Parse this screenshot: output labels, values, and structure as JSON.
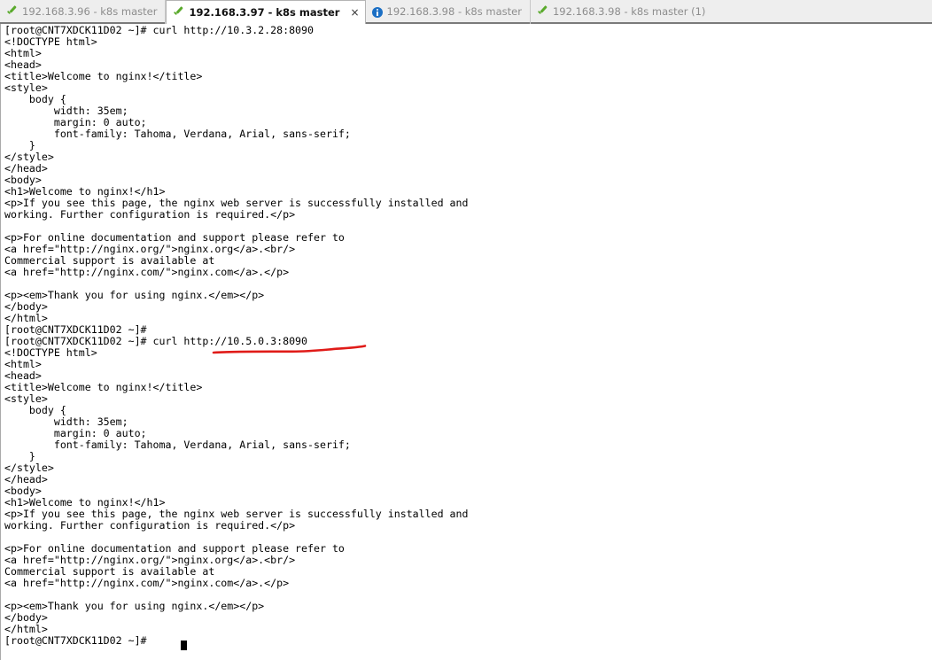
{
  "window": {
    "title": "192.168.3.97 - k8s master"
  },
  "tabbar": {
    "tabs": [
      {
        "label": "192.168.3.96 - k8s master",
        "icon": "green-check-icon",
        "active": false,
        "closable": false
      },
      {
        "label": "192.168.3.97 - k8s master",
        "icon": "green-check-icon",
        "active": true,
        "closable": true,
        "close_label": "×"
      },
      {
        "label": "192.168.3.98 - k8s master",
        "icon": "blue-info-icon",
        "active": false,
        "closable": false
      },
      {
        "label": "192.168.3.98 - k8s master (1)",
        "icon": "green-check-icon",
        "active": false,
        "closable": false
      }
    ]
  },
  "colors": {
    "tabbar_background": "#eeeeee",
    "tabbar_border": "#7a7a7a",
    "active_tab_background": "#ffffff",
    "inactive_tab_text": "#8d8d8d",
    "active_tab_text": "#111111",
    "check_icon": "#5aaa2c",
    "info_icon": "#1b6fc4",
    "terminal_background": "#ffffff",
    "terminal_text": "#000000",
    "annotation_red": "#e01b18"
  },
  "terminal": {
    "prompt": "[root@CNT7XDCK11D02 ~]#",
    "hostname": "CNT7XDCK11D02",
    "user": "root",
    "cwd": "~",
    "commands": [
      "curl http://10.3.2.28:8090",
      "curl http://10.5.0.3:8090"
    ],
    "content": "[root@CNT7XDCK11D02 ~]# curl http://10.3.2.28:8090\n<!DOCTYPE html>\n<html>\n<head>\n<title>Welcome to nginx!</title>\n<style>\n    body {\n        width: 35em;\n        margin: 0 auto;\n        font-family: Tahoma, Verdana, Arial, sans-serif;\n    }\n</style>\n</head>\n<body>\n<h1>Welcome to nginx!</h1>\n<p>If you see this page, the nginx web server is successfully installed and\nworking. Further configuration is required.</p>\n\n<p>For online documentation and support please refer to\n<a href=\"http://nginx.org/\">nginx.org</a>.<br/>\nCommercial support is available at\n<a href=\"http://nginx.com/\">nginx.com</a>.</p>\n\n<p><em>Thank you for using nginx.</em></p>\n</body>\n</html>\n[root@CNT7XDCK11D02 ~]#\n[root@CNT7XDCK11D02 ~]# curl http://10.5.0.3:8090\n<!DOCTYPE html>\n<html>\n<head>\n<title>Welcome to nginx!</title>\n<style>\n    body {\n        width: 35em;\n        margin: 0 auto;\n        font-family: Tahoma, Verdana, Arial, sans-serif;\n    }\n</style>\n</head>\n<body>\n<h1>Welcome to nginx!</h1>\n<p>If you see this page, the nginx web server is successfully installed and\nworking. Further configuration is required.</p>\n\n<p>For online documentation and support please refer to\n<a href=\"http://nginx.org/\">nginx.org</a>.<br/>\nCommercial support is available at\n<a href=\"http://nginx.com/\">nginx.com</a>.</p>\n\n<p><em>Thank you for using nginx.</em></p>\n</body>\n</html>\n[root@CNT7XDCK11D02 ~]# "
  },
  "annotation": {
    "type": "hand-drawn-underline",
    "color": "#e01b18",
    "underlines_text": "http://10.5.0.3:8090"
  }
}
